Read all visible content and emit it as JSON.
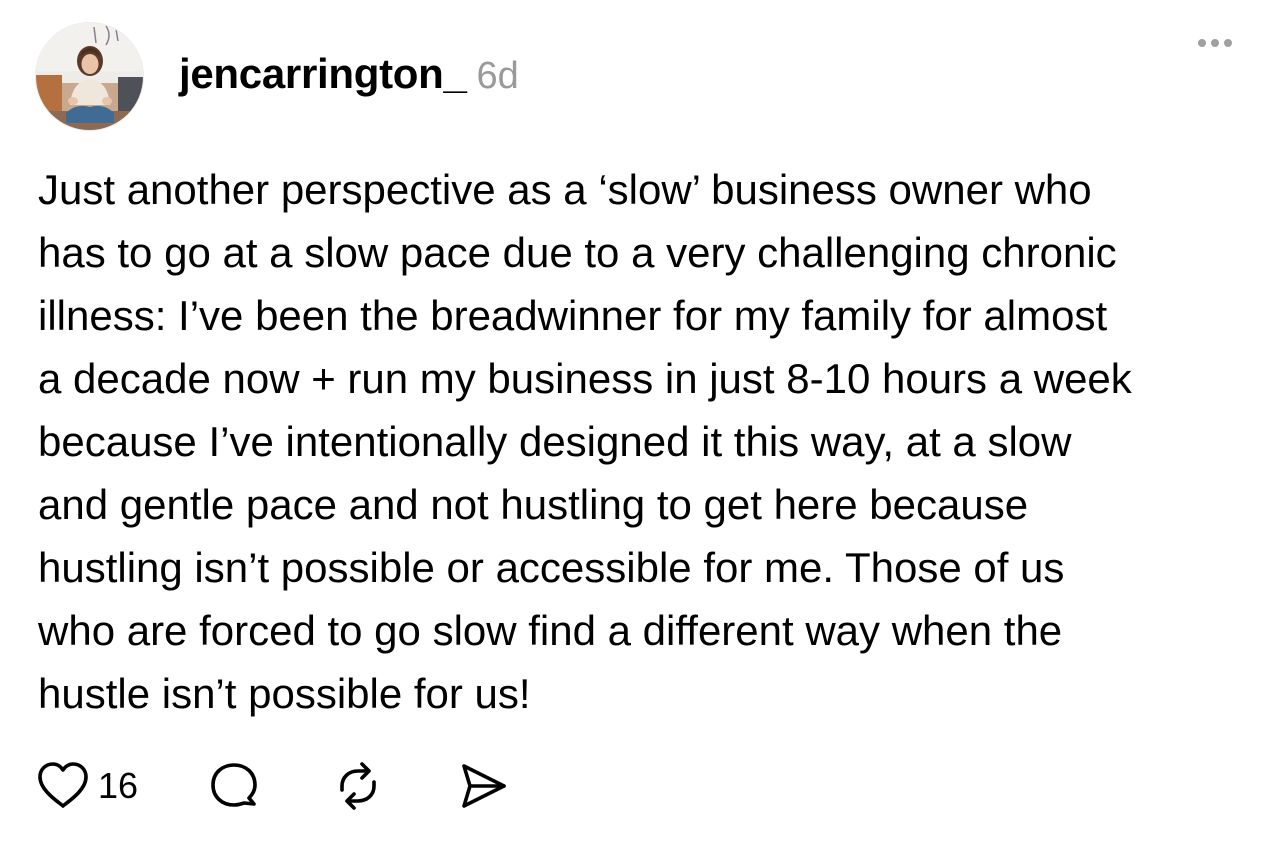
{
  "post": {
    "username": "jencarrington_",
    "time_ago": "6d",
    "avatar_icon": "user-avatar-photo",
    "more_icon": "more-dots-icon",
    "body_lines": [
      "Just another perspective as a ‘slow’ business owner who",
      "has to go at a slow pace due to a very challenging chronic",
      "illness: I’ve been the breadwinner for my family for almost",
      "a decade now + run my business in just 8-10 hours a week",
      "because I’ve intentionally designed it this way, at a slow",
      "and gentle pace and not hustling to get here because",
      "hustling isn’t possible or accessible for me. Those of us",
      "who are forced to go slow find a different way when the",
      "hustle isn’t possible for us!"
    ],
    "actions": {
      "like_icon": "heart-icon",
      "like_count": "16",
      "comment_icon": "comment-bubble-icon",
      "repost_icon": "repost-icon",
      "share_icon": "send-icon"
    }
  },
  "colors": {
    "text": "#000000",
    "muted": "#9a9a9a",
    "background": "#ffffff"
  }
}
